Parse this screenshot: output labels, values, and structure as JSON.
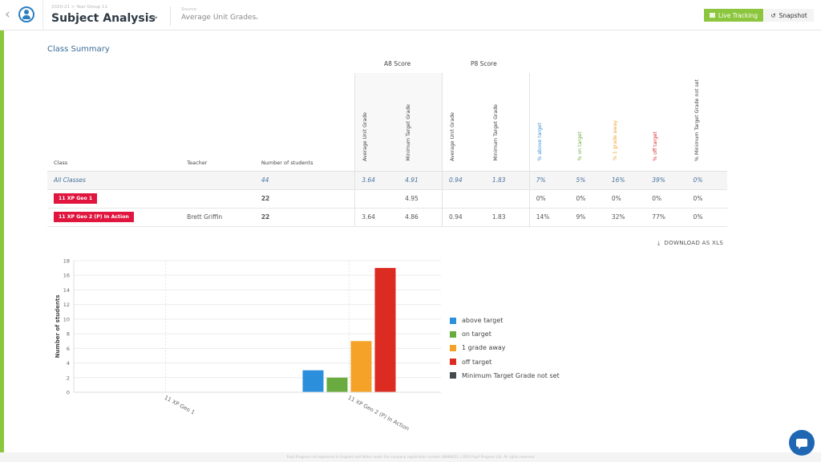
{
  "header": {
    "breadcrumb": "2020-21 > Year Group 11",
    "title": "Subject Analysis",
    "source_label": "Source",
    "source_value": "Average Unit Grades",
    "live_tracking_label": "Live Tracking",
    "snapshot_label": "Snapshot",
    "accent_color": "#8cc63f"
  },
  "section": {
    "title": "Class Summary",
    "group_a8": "A8 Score",
    "group_p8": "P8 Score"
  },
  "table": {
    "columns": {
      "class": "Class",
      "teacher": "Teacher",
      "students": "Number of students",
      "a8_avg": "Average Unit Grade",
      "a8_min": "Minimum Target Grade",
      "p8_avg": "Average Unit Grade",
      "p8_min": "Minimum Target Grade",
      "above": "% above target",
      "on": "% on target",
      "away": "% 1 grade away",
      "off": "% off target",
      "notset": "% Minimum Target Grade not set"
    },
    "rows": [
      {
        "class": "All Classes",
        "teacher": "",
        "students": "44",
        "a8_avg": "3.64",
        "a8_min": "4.91",
        "p8_avg": "0.94",
        "p8_min": "1.83",
        "above": "7%",
        "on": "5%",
        "away": "16%",
        "off": "39%",
        "notset": "0%"
      },
      {
        "class": "11 XP Geo 1",
        "teacher": "",
        "students": "22",
        "a8_avg": "",
        "a8_min": "4.95",
        "p8_avg": "",
        "p8_min": "",
        "above": "0%",
        "on": "0%",
        "away": "0%",
        "off": "0%",
        "notset": "0%"
      },
      {
        "class": "11 XP Geo 2 (P) In Action",
        "teacher": "Brett Griffin",
        "students": "22",
        "a8_avg": "3.64",
        "a8_min": "4.86",
        "p8_avg": "0.94",
        "p8_min": "1.83",
        "above": "14%",
        "on": "9%",
        "away": "32%",
        "off": "77%",
        "notset": "0%"
      }
    ],
    "class_tag_color": "#e0163f"
  },
  "download_label": "DOWNLOAD AS XLS",
  "chart_data": {
    "type": "bar",
    "title": "",
    "xlabel": "",
    "ylabel": "Number of students",
    "ylim": [
      0,
      18
    ],
    "yticks": [
      0,
      2,
      4,
      6,
      8,
      10,
      12,
      14,
      16,
      18
    ],
    "categories": [
      "11 XP Geo 1",
      "11 XP Geo 2 (P) In Action"
    ],
    "series": [
      {
        "name": "above target",
        "color": "#2b8fdc",
        "values": [
          0,
          3
        ]
      },
      {
        "name": "on target",
        "color": "#6aab3f",
        "values": [
          0,
          2
        ]
      },
      {
        "name": "1 grade away",
        "color": "#f5a328",
        "values": [
          0,
          7
        ]
      },
      {
        "name": "off target",
        "color": "#dc2b20",
        "values": [
          0,
          17
        ]
      },
      {
        "name": "Minimum Target Grade not set",
        "color": "#454a4e",
        "values": [
          0,
          0
        ]
      }
    ],
    "grid": true,
    "legend": "right"
  },
  "footer": {
    "text": "Pupil Progress Ltd registered in England and Wales under the company registration number 08888421   |   2020 Pupil Progress Ltd. All rights reserved"
  },
  "chat_label": "chat-widget"
}
